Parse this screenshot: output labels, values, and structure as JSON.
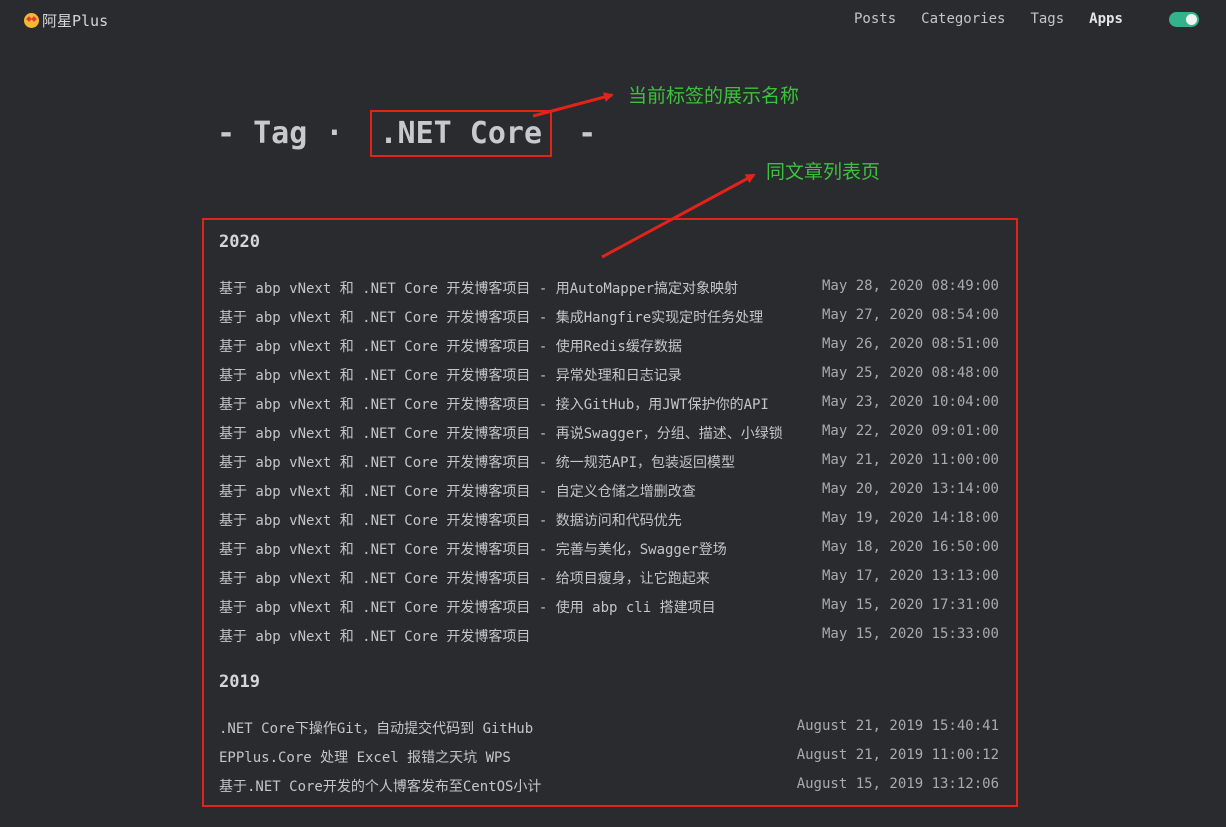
{
  "header": {
    "brand": "阿星Plus",
    "nav": [
      "Posts",
      "Categories",
      "Tags",
      "Apps"
    ],
    "active": "Apps",
    "theme_toggle_on": true
  },
  "page": {
    "prefix": "- Tag · ",
    "tag": ".NET Core",
    "suffix": " -"
  },
  "annotations": {
    "tag_name_note": "当前标签的展示名称",
    "list_note": "同文章列表页"
  },
  "years": [
    {
      "year": "2020",
      "posts": [
        {
          "title": "基于 abp vNext 和 .NET Core 开发博客项目 - 用AutoMapper搞定对象映射",
          "date": "May 28, 2020 08:49:00"
        },
        {
          "title": "基于 abp vNext 和 .NET Core 开发博客项目 - 集成Hangfire实现定时任务处理",
          "date": "May 27, 2020 08:54:00"
        },
        {
          "title": "基于 abp vNext 和 .NET Core 开发博客项目 - 使用Redis缓存数据",
          "date": "May 26, 2020 08:51:00"
        },
        {
          "title": "基于 abp vNext 和 .NET Core 开发博客项目 - 异常处理和日志记录",
          "date": "May 25, 2020 08:48:00"
        },
        {
          "title": "基于 abp vNext 和 .NET Core 开发博客项目 - 接入GitHub，用JWT保护你的API",
          "date": "May 23, 2020 10:04:00"
        },
        {
          "title": "基于 abp vNext 和 .NET Core 开发博客项目 - 再说Swagger，分组、描述、小绿锁",
          "date": "May 22, 2020 09:01:00"
        },
        {
          "title": "基于 abp vNext 和 .NET Core 开发博客项目 - 统一规范API，包装返回模型",
          "date": "May 21, 2020 11:00:00"
        },
        {
          "title": "基于 abp vNext 和 .NET Core 开发博客项目 - 自定义仓储之增删改查",
          "date": "May 20, 2020 13:14:00"
        },
        {
          "title": "基于 abp vNext 和 .NET Core 开发博客项目 - 数据访问和代码优先",
          "date": "May 19, 2020 14:18:00"
        },
        {
          "title": "基于 abp vNext 和 .NET Core 开发博客项目 - 完善与美化，Swagger登场",
          "date": "May 18, 2020 16:50:00"
        },
        {
          "title": "基于 abp vNext 和 .NET Core 开发博客项目 - 给项目瘦身，让它跑起来",
          "date": "May 17, 2020 13:13:00"
        },
        {
          "title": "基于 abp vNext 和 .NET Core 开发博客项目 - 使用 abp cli 搭建项目",
          "date": "May 15, 2020 17:31:00"
        },
        {
          "title": "基于 abp vNext 和 .NET Core 开发博客项目",
          "date": "May 15, 2020 15:33:00"
        }
      ]
    },
    {
      "year": "2019",
      "posts": [
        {
          "title": ".NET Core下操作Git，自动提交代码到 GitHub",
          "date": "August 21, 2019 15:40:41"
        },
        {
          "title": "EPPlus.Core 处理 Excel 报错之天坑 WPS",
          "date": "August 21, 2019 11:00:12"
        },
        {
          "title": "基于.NET Core开发的个人博客发布至CentOS小计",
          "date": "August 15, 2019 13:12:06"
        }
      ]
    }
  ]
}
